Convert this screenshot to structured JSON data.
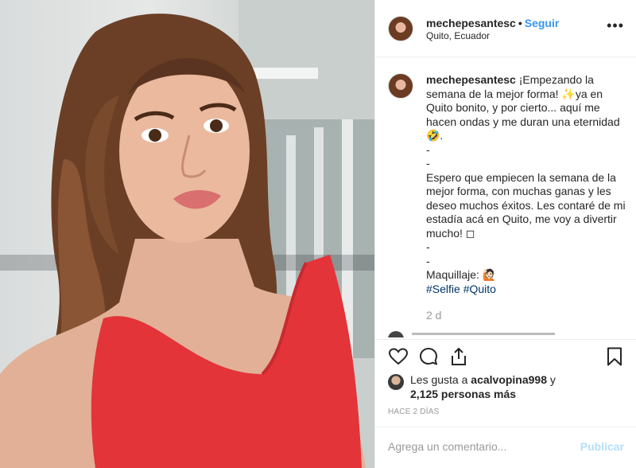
{
  "header": {
    "username": "mechepesantesc",
    "separator": "•",
    "follow_label": "Seguir",
    "location": "Quito, Ecuador",
    "more_icon": "more-horizontal-icon"
  },
  "caption": {
    "username": "mechepesantesc",
    "text": " ¡Empezando la semana de la mejor forma! ✨ya en Quito bonito, y por cierto... aquí me hacen ondas y me duran una eternidad🤣.\n-\n-\nEspero que empiecen la semana de la mejor forma, con muchas ganas y les deseo muchos éxitos. Les contaré de mi estadía acá en Quito, me voy a divertir mucho! ◻\n-\n-\nMaquillaje: 🙋🏻",
    "hashtags": "#Selfie #Quito",
    "age": "2 d"
  },
  "likes": {
    "prefix": "Les gusta a ",
    "user": "acalvopina998",
    "joiner": " y",
    "count_text": "2,125 personas más"
  },
  "timestamp": "HACE 2 DÍAS",
  "comment": {
    "placeholder": "Agrega un comentario...",
    "publish_label": "Publicar"
  },
  "colors": {
    "accent": "#3897f0",
    "dress": "#e3343a",
    "publish_disabled": "#b2dffc"
  }
}
